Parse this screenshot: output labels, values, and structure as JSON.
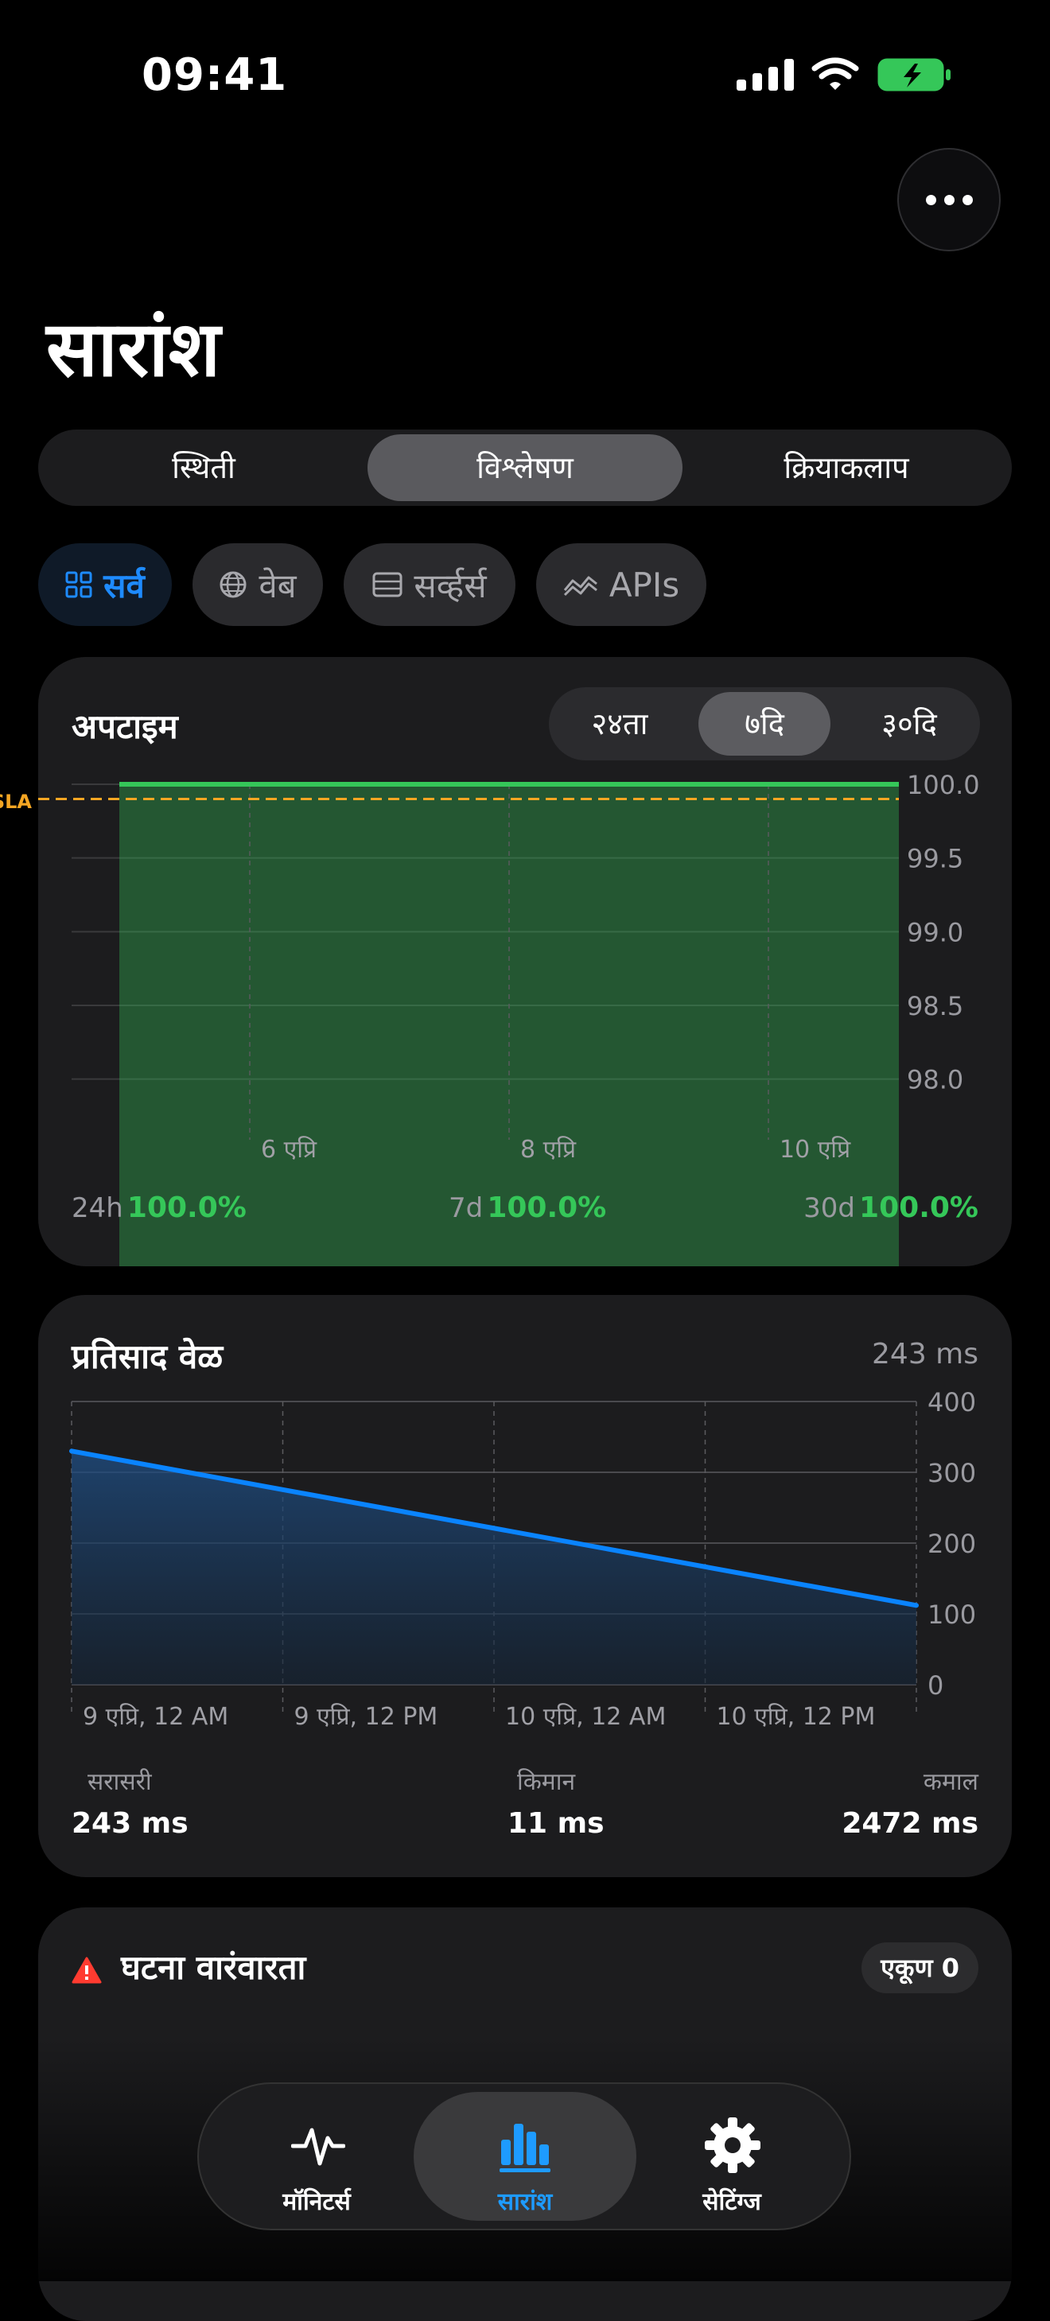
{
  "status_bar": {
    "time": "09:41"
  },
  "header": {
    "title": "सारांश"
  },
  "tabs": [
    {
      "label": "स्थिती",
      "active": false
    },
    {
      "label": "विश्लेषण",
      "active": true
    },
    {
      "label": "क्रियाकलाप",
      "active": false
    }
  ],
  "filters": [
    {
      "label": "सर्व",
      "icon": "grid-icon",
      "active": true
    },
    {
      "label": "वेब",
      "icon": "globe-icon",
      "active": false
    },
    {
      "label": "सर्व्हर्स",
      "icon": "server-icon",
      "active": false
    },
    {
      "label": "APIs",
      "icon": "api-wave-icon",
      "active": false
    }
  ],
  "uptime": {
    "title": "अपटाइम",
    "ranges": [
      {
        "label": "२४ता",
        "active": false
      },
      {
        "label": "७दि",
        "active": true
      },
      {
        "label": "३०दि",
        "active": false
      }
    ],
    "sla_label": "SLA",
    "stats": [
      {
        "label": "24h",
        "value": "100.0%"
      },
      {
        "label": "7d",
        "value": "100.0%"
      },
      {
        "label": "30d",
        "value": "100.0%"
      }
    ]
  },
  "response": {
    "title": "प्रतिसाद वेळ",
    "current": "243 ms",
    "stats": [
      {
        "label": "सरासरी",
        "value": "243 ms"
      },
      {
        "label": "किमान",
        "value": "11 ms"
      },
      {
        "label": "कमाल",
        "value": "2472 ms"
      }
    ]
  },
  "incidents": {
    "title": "घटना वारंवारता",
    "badge": "एकूण 0"
  },
  "nav": [
    {
      "label": "मॉनिटर्स",
      "icon": "activity-pulse-icon",
      "active": false
    },
    {
      "label": "सारांश",
      "icon": "bar-chart-icon",
      "active": true
    },
    {
      "label": "सेटिंग्ज",
      "icon": "gear-icon",
      "active": false
    }
  ],
  "colors": {
    "accent": "#1e8bff",
    "success": "#35c759",
    "sla": "#f5a623",
    "response_line": "#0a84ff"
  },
  "chart_data": [
    {
      "type": "area",
      "name": "uptime",
      "x": [
        "6 एप्रि",
        "8 एप्रि",
        "10 एप्रि"
      ],
      "ylabel": "",
      "ylim": [
        97.75,
        100.0
      ],
      "yticks": [
        "100.0",
        "99.5",
        "99.0",
        "98.5",
        "98.0"
      ],
      "series": [
        {
          "values": [
            100.0,
            100.0,
            100.0,
            100.0,
            100.0,
            100.0,
            100.0
          ]
        }
      ],
      "sla_line": 99.9,
      "grid": true
    },
    {
      "type": "area",
      "name": "response_time",
      "x": [
        "9 एप्रि, 12 AM",
        "9 एप्रि, 12 PM",
        "10 एप्रि, 12 AM",
        "10 एप्रि, 12 PM"
      ],
      "ylim": [
        0,
        400
      ],
      "yticks": [
        "400",
        "300",
        "200",
        "100",
        "0"
      ],
      "series": [
        {
          "values": [
            330,
            112
          ]
        }
      ],
      "grid": true
    }
  ]
}
